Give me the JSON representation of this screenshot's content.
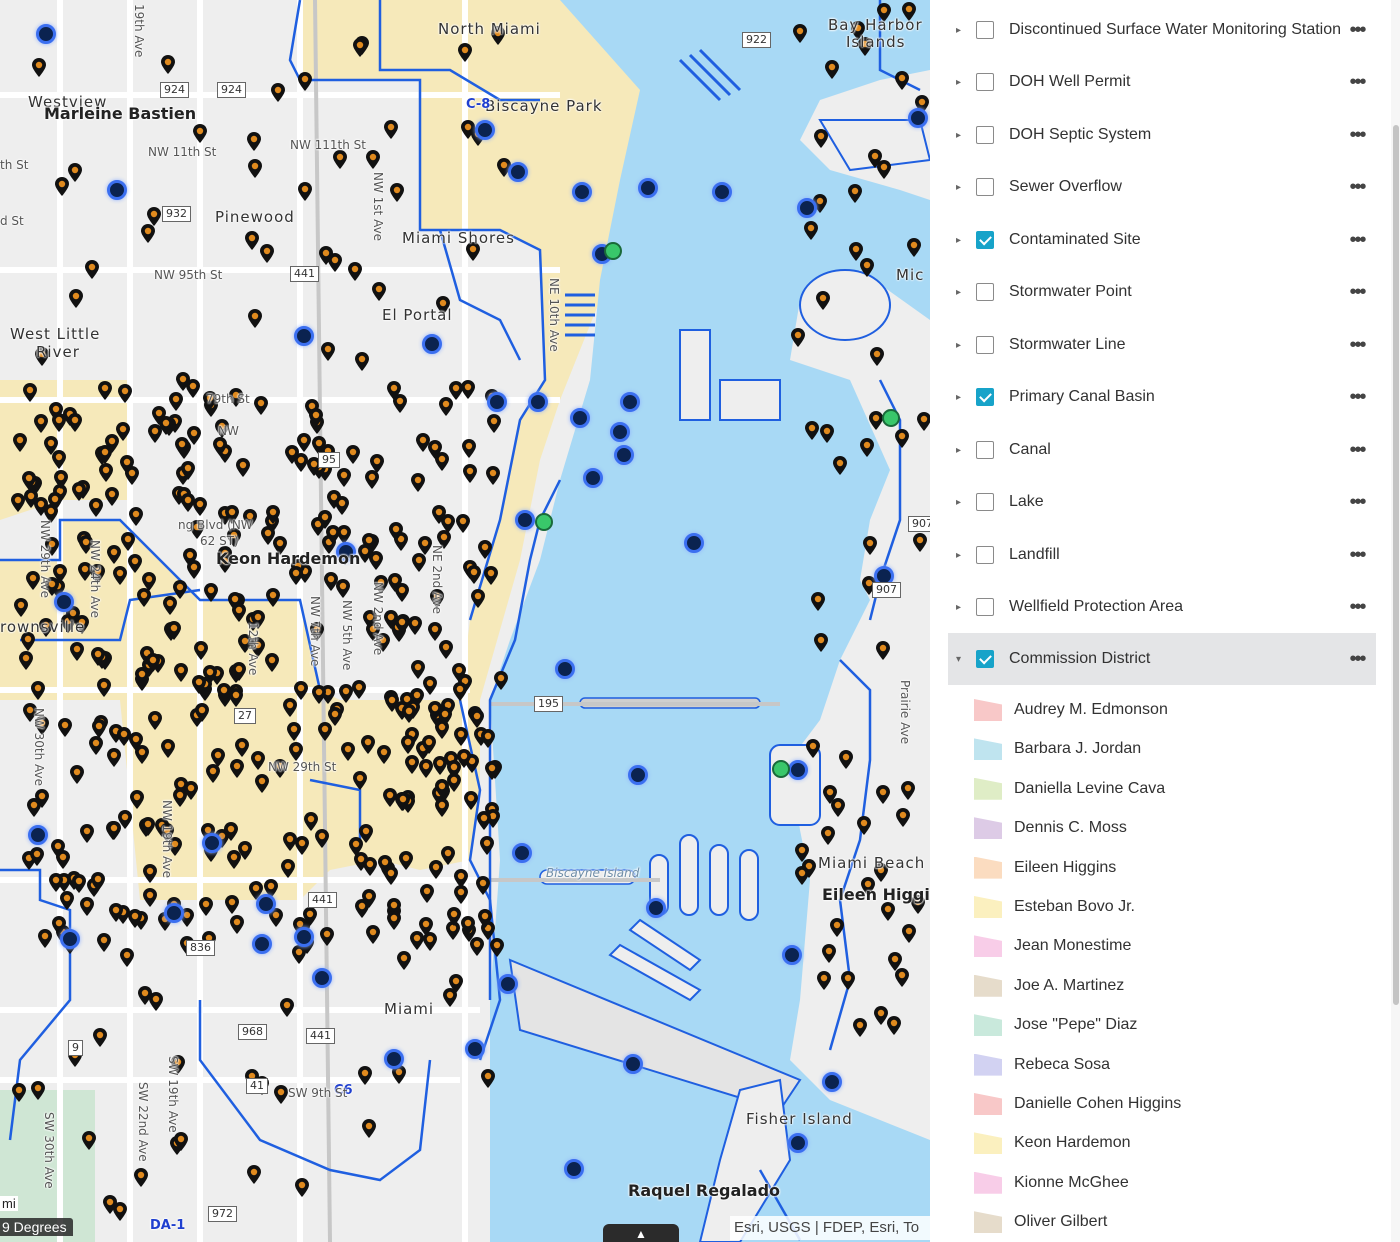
{
  "map": {
    "place_labels": [
      {
        "text": "North Miami",
        "kind": "place"
      },
      {
        "text": "Bay Harbor",
        "kind": "place"
      },
      {
        "text": "Islands",
        "kind": "place"
      },
      {
        "text": "Westview",
        "kind": "place"
      },
      {
        "text": "Marleine Bastien",
        "kind": "big"
      },
      {
        "text": "Biscayne Park",
        "kind": "place"
      },
      {
        "text": "C-8",
        "kind": "blue"
      },
      {
        "text": "Pinewood",
        "kind": "place"
      },
      {
        "text": "Miami Shores",
        "kind": "place"
      },
      {
        "text": "El Portal",
        "kind": "place"
      },
      {
        "text": "West Little",
        "kind": "place"
      },
      {
        "text": "River",
        "kind": "place"
      },
      {
        "text": "Keon Hardemon",
        "kind": "big"
      },
      {
        "text": "rownsville",
        "kind": "place"
      },
      {
        "text": "Miami Beach",
        "kind": "place"
      },
      {
        "text": "Eileen Higgins",
        "kind": "big"
      },
      {
        "text": "Miami",
        "kind": "place"
      },
      {
        "text": "Fisher Island",
        "kind": "place"
      },
      {
        "text": "Raquel Regalado",
        "kind": "big"
      },
      {
        "text": "Biscayne Island",
        "kind": "italic"
      },
      {
        "text": "DA-1",
        "kind": "blue"
      },
      {
        "text": "C6",
        "kind": "blue"
      },
      {
        "text": "Mic",
        "kind": "place"
      }
    ],
    "street_labels": [
      "NW 111th St",
      "NW 11th St",
      "NW 95th St",
      "79th St",
      "NW 1st Ave",
      "NE 10th Ave",
      "NE 2nd Ave",
      "NW 2nd Ave",
      "NW 5th Ave",
      "NW 7th Ave",
      "12th Ave",
      "NW 24th Ave",
      "NW 29th Ave",
      "NW 30th Ave",
      "NW 19th Ave",
      "SW 9th St",
      "SW 30th Ave",
      "SW 22nd Ave",
      "SW 19th Ave",
      "19th Ave",
      "NW 29th St",
      "Prairie Ave",
      "th St",
      "d St",
      "ng Blvd (NW",
      "62 ST)",
      "NW"
    ],
    "shields": [
      "924",
      "924",
      "932",
      "441",
      "95",
      "195",
      "27",
      "441",
      "836",
      "968",
      "441",
      "9",
      "41",
      "972",
      "907",
      "907",
      "922"
    ],
    "attribution": "Esri, USGS | FDEP, Esri, To",
    "scale_text": "9 Degrees",
    "scale_unit": "mi",
    "colors": {
      "water": "#a8d9f5",
      "land": "#eeeeee",
      "district_fill": "#f7e8b0",
      "boundary": "#1f5fe0",
      "pin": "#e08a1e",
      "station": "#39c76a"
    }
  },
  "panel": {
    "layers": [
      {
        "label": "Discontinued Surface Water Monitoring Station",
        "checked": false
      },
      {
        "label": "DOH Well Permit",
        "checked": false
      },
      {
        "label": "DOH Septic System",
        "checked": false
      },
      {
        "label": "Sewer Overflow",
        "checked": false
      },
      {
        "label": "Contaminated Site",
        "checked": true
      },
      {
        "label": "Stormwater Point",
        "checked": false
      },
      {
        "label": "Stormwater Line",
        "checked": false
      },
      {
        "label": "Primary Canal Basin",
        "checked": true
      },
      {
        "label": "Canal",
        "checked": false
      },
      {
        "label": "Lake",
        "checked": false
      },
      {
        "label": "Landfill",
        "checked": false
      },
      {
        "label": "Wellfield Protection Area",
        "checked": false
      },
      {
        "label": "Commission District",
        "checked": true,
        "expanded": true
      }
    ],
    "legend": [
      {
        "label": "Audrey M. Edmonson",
        "color": "#f8c8c8"
      },
      {
        "label": "Barbara J. Jordan",
        "color": "#bfe4ef"
      },
      {
        "label": "Daniella Levine Cava",
        "color": "#dfedc6"
      },
      {
        "label": "Dennis C. Moss",
        "color": "#ddcbe6"
      },
      {
        "label": "Eileen Higgins",
        "color": "#fbdcc0"
      },
      {
        "label": "Esteban Bovo Jr.",
        "color": "#fbf0bf"
      },
      {
        "label": "Jean Monestime",
        "color": "#f8cde8"
      },
      {
        "label": "Joe A. Martinez",
        "color": "#e6dccb"
      },
      {
        "label": "Jose \"Pepe\" Diaz",
        "color": "#c9e9dc"
      },
      {
        "label": "Rebeca Sosa",
        "color": "#d2d2f2"
      },
      {
        "label": "Danielle Cohen Higgins",
        "color": "#f8c8c8"
      },
      {
        "label": "Keon Hardemon",
        "color": "#fbf0bf"
      },
      {
        "label": "Kionne McGhee",
        "color": "#f8cde8"
      },
      {
        "label": "Oliver Gilbert",
        "color": "#e6dccb"
      }
    ]
  }
}
